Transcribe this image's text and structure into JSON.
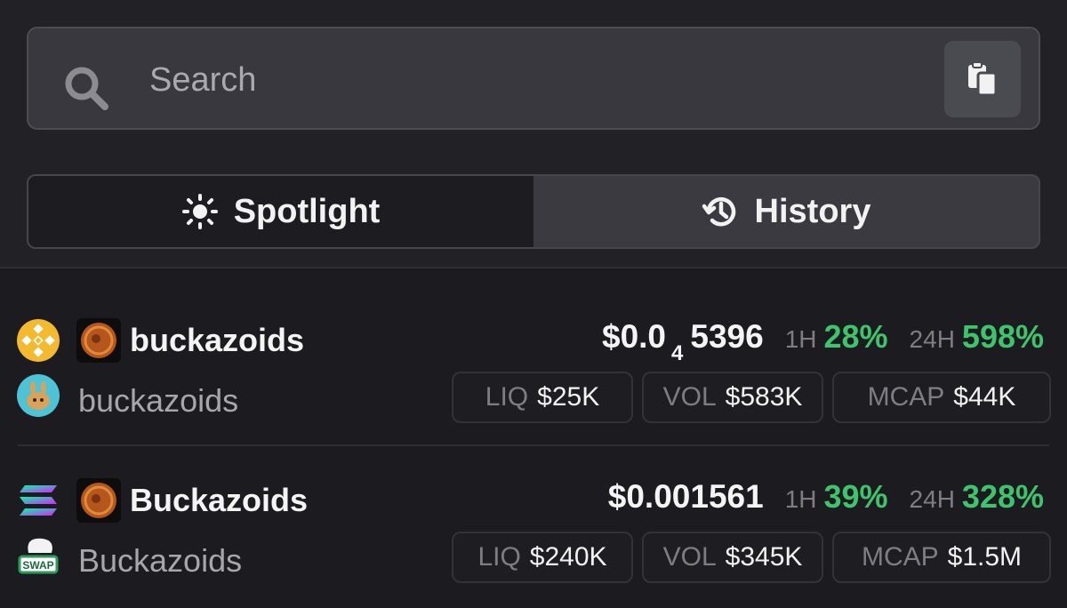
{
  "search": {
    "placeholder": "Search",
    "search_icon": "search-icon",
    "paste_icon": "clipboard-icon"
  },
  "tabs": [
    {
      "label": "Spotlight",
      "icon": "sun-icon",
      "active": true
    },
    {
      "label": "History",
      "icon": "history-icon",
      "active": false
    }
  ],
  "tokens": [
    {
      "chain_icon": "bnb-icon",
      "dex_icon": "pancakeswap-icon",
      "name": "buckazoids",
      "sub_name": "buckazoids",
      "price_prefix": "$0.0",
      "price_subscript": "4",
      "price_suffix": "5396",
      "h1_label": "1H",
      "h1_value": "28%",
      "h24_label": "24H",
      "h24_value": "598%",
      "liq_label": "LIQ",
      "liq_value": "$25K",
      "vol_label": "VOL",
      "vol_value": "$583K",
      "mcap_label": "MCAP",
      "mcap_value": "$44K"
    },
    {
      "chain_icon": "solana-icon",
      "dex_icon": "swap-icon",
      "name": "Buckazoids",
      "sub_name": "Buckazoids",
      "price_full": "$0.001561",
      "h1_label": "1H",
      "h1_value": "39%",
      "h24_label": "24H",
      "h24_value": "328%",
      "liq_label": "LIQ",
      "liq_value": "$240K",
      "vol_label": "VOL",
      "vol_value": "$345K",
      "mcap_label": "MCAP",
      "mcap_value": "$1.5M"
    }
  ],
  "colors": {
    "positive": "#3ec46d",
    "bnb": "#f3ba2f",
    "pancake": "#4ec3d5"
  }
}
